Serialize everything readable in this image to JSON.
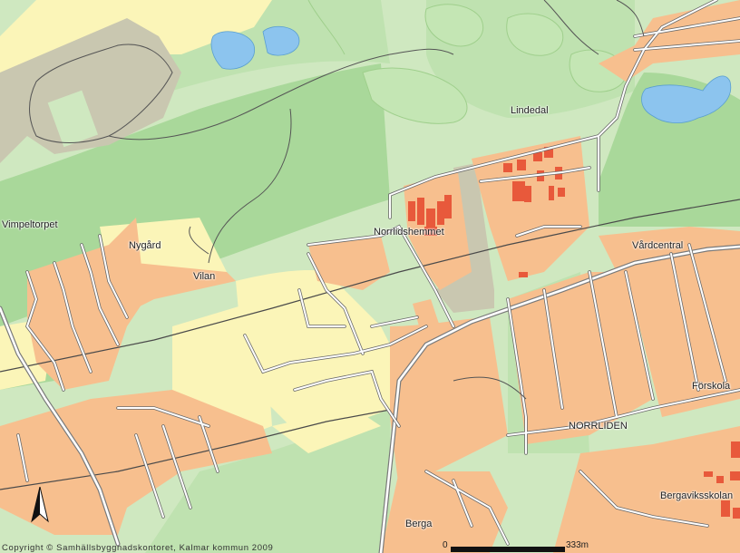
{
  "map": {
    "place_labels": {
      "lindedal": "Lindedal",
      "vimpeltorpet": "Vimpeltorpet",
      "nygard": "Nygård",
      "vilan": "Vilan",
      "norrlidshemmet": "Norrlidshemmet",
      "vardcentral": "Vårdcentral",
      "forskola": "Förskola",
      "norrliden": "NORRLIDEN",
      "bergaviksskolan": "Bergaviksskolan",
      "berga": "Berga"
    },
    "copyright": "Copyright © Samhällsbyggnadskontoret, Kalmar kommun 2009",
    "scale_bar": {
      "start": "0",
      "end": "333m"
    },
    "colors": {
      "background_green": "#cfe8c0",
      "forest_green": "#a9d89a",
      "field_yellow": "#fbf5b8",
      "residential": "#f7bf8e",
      "building": "#e8593b",
      "industrial_gray": "#c9c7b0",
      "water": "#8cc4ee",
      "road": "#7a7a7a"
    },
    "icons": {
      "north_arrow": "north-arrow-icon"
    }
  }
}
